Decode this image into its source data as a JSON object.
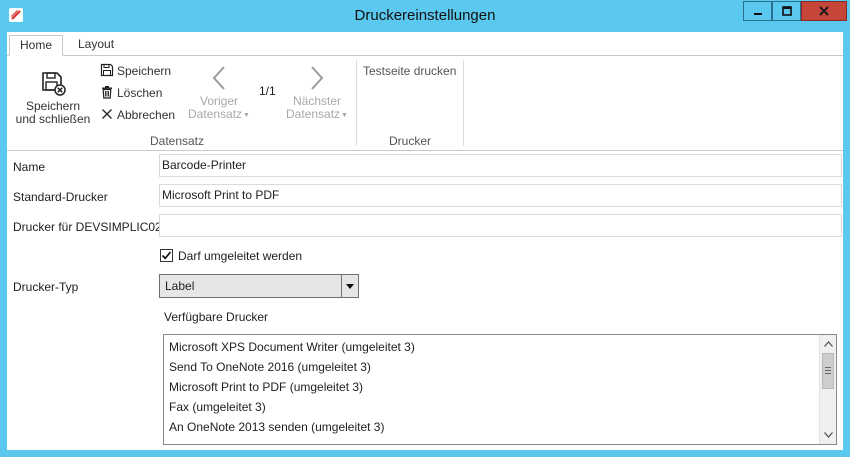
{
  "window": {
    "title": "Druckereinstellungen",
    "accent_color": "#5bc8ef",
    "close_color": "#c7463a"
  },
  "ribbon": {
    "tabs": [
      {
        "label": "Home",
        "active": true
      },
      {
        "label": "Layout",
        "active": false
      }
    ],
    "datensatz": {
      "group_label": "Datensatz",
      "save_close_line1": "Speichern",
      "save_close_line2": "und schließen",
      "save": "Speichern",
      "delete": "Löschen",
      "cancel": "Abbrechen",
      "prev_line1": "Voriger",
      "prev_line2": "Datensatz",
      "page_indicator": "1/1",
      "next_line1": "Nächster",
      "next_line2": "Datensatz"
    },
    "drucker": {
      "group_label": "Drucker",
      "test_print": "Testseite drucken"
    }
  },
  "form": {
    "name_label": "Name",
    "name_value": "Barcode-Printer",
    "default_printer_label": "Standard-Drucker",
    "default_printer_value": "Microsoft Print to PDF",
    "printer_for_label": "Drucker für DEVSIMPLIC02",
    "printer_for_value": "",
    "redirect_checkbox_label": "Darf umgeleitet werden",
    "redirect_checked": true,
    "printer_type_label": "Drucker-Typ",
    "printer_type_value": "Label",
    "available_printers_label": "Verfügbare Drucker",
    "available_printers": [
      "Microsoft XPS Document Writer (umgeleitet 3)",
      "Send To OneNote 2016 (umgeleitet 3)",
      "Microsoft Print to PDF (umgeleitet 3)",
      "Fax (umgeleitet 3)",
      "An OneNote 2013 senden (umgeleitet 3)"
    ]
  }
}
